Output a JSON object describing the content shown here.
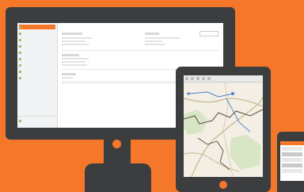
{
  "colors": {
    "brand_orange": "#f5782a",
    "device_dark": "#3c3d3f",
    "link_blue": "#4aa3df",
    "map_bg": "#f3efe4"
  },
  "desktop": {
    "topbar_tabs": [
      "",
      "",
      "",
      "",
      "",
      "",
      ""
    ],
    "sidebar": {
      "items": [
        {
          "label": "",
          "active": true
        },
        {
          "label": "",
          "active": false
        },
        {
          "label": "",
          "active": false
        },
        {
          "label": "",
          "active": false
        },
        {
          "label": "",
          "active": false
        },
        {
          "label": "",
          "active": false
        },
        {
          "label": "",
          "active": false
        },
        {
          "label": "",
          "active": false
        },
        {
          "label": "",
          "active": false
        },
        {
          "label": "",
          "active": false
        }
      ]
    },
    "main": {
      "breadcrumb": "",
      "title": "",
      "edit_button": "",
      "sections": []
    }
  },
  "tablet": {
    "app": "map",
    "toolbar_icons": [
      "zoom-in-icon",
      "zoom-out-icon",
      "layers-icon",
      "pan-icon",
      "measure-icon"
    ]
  },
  "phone": {
    "app": "mobile-list"
  }
}
